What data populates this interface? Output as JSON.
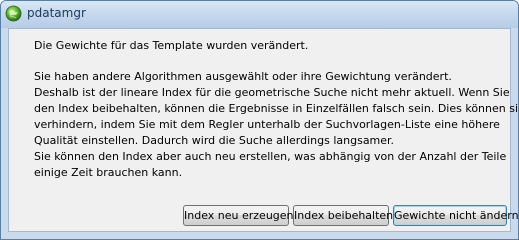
{
  "window": {
    "title": "pdatamgr",
    "icon": "app-globe-icon"
  },
  "message": {
    "line1": "Die Gewichte für das Template wurden verändert.",
    "paragraph": [
      "Sie haben andere Algorithmen ausgewählt oder ihre Gewichtung verändert.",
      "Deshalb ist der lineare Index für die geometrische Suche nicht mehr aktuell. Wenn Sie",
      "den Index beibehalten, können die Ergebnisse in Einzelfällen falsch sein. Dies können sie",
      "verhindern, indem Sie mit dem Regler unterhalb der Suchvorlagen-Liste eine höhere",
      "Qualität einstellen. Dadurch wird die Suche allerdings langsamer.",
      "Sie können den Index aber auch neu erstellen, was abhängig von der Anzahl der Teile",
      "einige Zeit brauchen kann."
    ]
  },
  "buttons": {
    "rebuild": "Index neu erzeugen",
    "keep": "Index beibehalten",
    "keep_weights": "Gewichte nicht ändern"
  },
  "colors": {
    "frame": "#c6d9ee",
    "client": "#f0f0f0",
    "title_text": "#1e395b"
  }
}
